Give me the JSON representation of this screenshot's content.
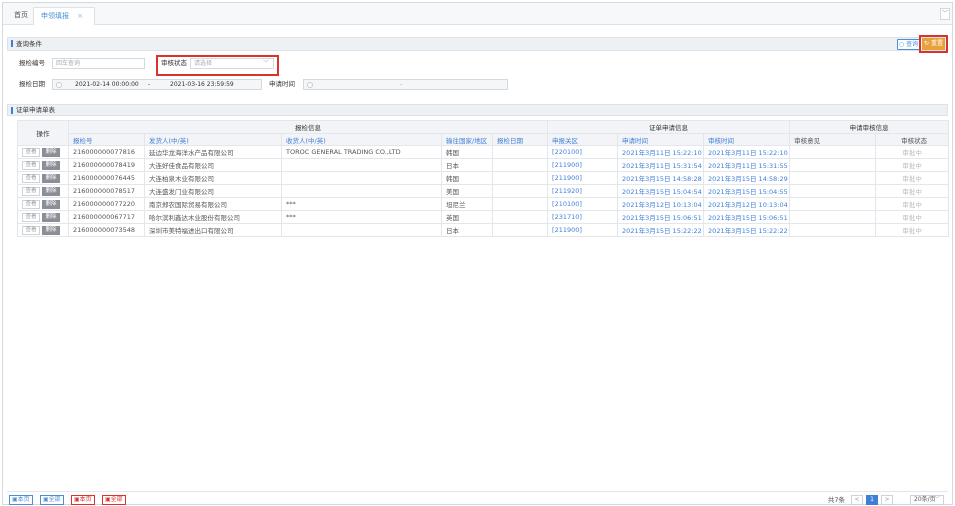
{
  "tabs": {
    "home": "首页",
    "active": "申领填报",
    "close": "×",
    "more": "﹀"
  },
  "query": {
    "title": "查询条件",
    "buttons": {
      "query": "查询",
      "reset": "重置"
    },
    "inspection_no": {
      "label": "报检编号",
      "placeholder": "回车查询"
    },
    "audit_status": {
      "label": "审核状态",
      "placeholder": "请选择"
    },
    "inspection_date": {
      "label": "报检日期",
      "from": "2021-02-14 00:00:00",
      "sep": "-",
      "to": "2021-03-16 23:59:59"
    },
    "apply_time": {
      "label": "申请时间",
      "sep": "-"
    }
  },
  "table": {
    "title": "证单申请单表",
    "groups": {
      "ops": "操作",
      "inspection": "报检信息",
      "cert": "证单申请信息",
      "audit": "申请审核信息"
    },
    "columns": [
      "报检号",
      "发货人(中/英)",
      "收货人(中/英)",
      "输往国家/地区",
      "报检日期",
      "申报关区",
      "申请时间",
      "审核时间",
      "审核意见",
      "审核状态"
    ],
    "op_view": "查看",
    "op_delete": "删除",
    "rows": [
      {
        "no": "216000000077816",
        "shipper": "延边华龙海洋水产品有限公司",
        "consignee": "TOROC GENERAL TRADING CO.,LTD",
        "country": "韩国",
        "date": "",
        "port": "[220100]",
        "apply": "2021年3月11日 15:22:10",
        "audit": "2021年3月11日 15:22:10",
        "opinion": "",
        "status": "审批中"
      },
      {
        "no": "216000000078419",
        "shipper": "大连好佳食品有限公司",
        "consignee": "",
        "country": "日本",
        "date": "",
        "port": "[211900]",
        "apply": "2021年3月11日 15:31:54",
        "audit": "2021年3月11日 15:31:55",
        "opinion": "",
        "status": "审批中"
      },
      {
        "no": "216000000076445",
        "shipper": "大连柏泉木业有限公司",
        "consignee": "",
        "country": "韩国",
        "date": "",
        "port": "[211900]",
        "apply": "2021年3月15日 14:58:28",
        "audit": "2021年3月15日 14:58:29",
        "opinion": "",
        "status": "审批中"
      },
      {
        "no": "216000000078517",
        "shipper": "大连盛发门业有限公司",
        "consignee": "",
        "country": "美国",
        "date": "",
        "port": "[211920]",
        "apply": "2021年3月15日 15:04:54",
        "audit": "2021年3月15日 15:04:55",
        "opinion": "",
        "status": "审批中"
      },
      {
        "no": "216000000077220",
        "shipper": "南京郑农国际贸易有限公司",
        "consignee": "***",
        "country": "坦尼兰",
        "date": "",
        "port": "[210100]",
        "apply": "2021年3月12日 10:13:04",
        "audit": "2021年3月12日 10:13:04",
        "opinion": "",
        "status": "审批中"
      },
      {
        "no": "216000000067717",
        "shipper": "哈尔滨利鑫达木业股份有限公司",
        "consignee": "***",
        "country": "英国",
        "date": "",
        "port": "[231710]",
        "apply": "2021年3月15日 15:06:51",
        "audit": "2021年3月15日 15:06:51",
        "opinion": "",
        "status": "审批中"
      },
      {
        "no": "216000000073548",
        "shipper": "深圳市美特福进出口有限公司",
        "consignee": "",
        "country": "日本",
        "date": "",
        "port": "[211900]",
        "apply": "2021年3月15日 15:22:22",
        "audit": "2021年3月15日 15:22:22",
        "opinion": "",
        "status": "审批中"
      }
    ]
  },
  "footer": {
    "buttons": [
      {
        "label": "本页",
        "style": "blue"
      },
      {
        "label": "全部",
        "style": "blue"
      },
      {
        "label": "本页",
        "style": "red"
      },
      {
        "label": "全部",
        "style": "red"
      }
    ],
    "total": "共7条",
    "prev": "<",
    "page": "1",
    "next": ">",
    "page_size": "20条/页"
  },
  "colors": {
    "accent": "#3f7fd8",
    "reset": "#e8a23a",
    "highlight": "#d9342b"
  }
}
